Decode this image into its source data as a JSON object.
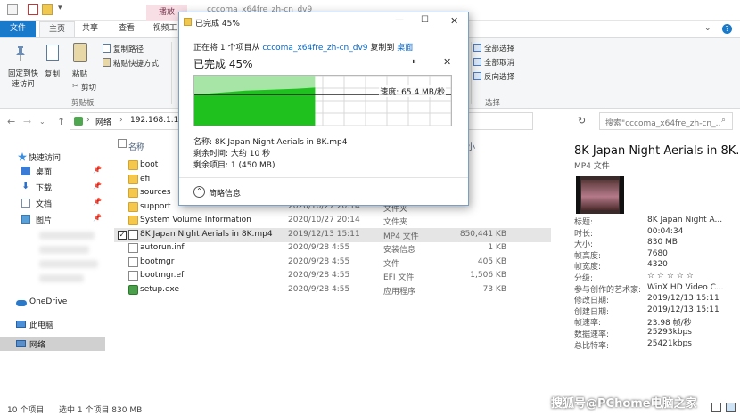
{
  "window": {
    "title": "cccoma_x64fre_zh-cn_dv9",
    "context_tab": "播放"
  },
  "quick_access": {
    "more": "▾"
  },
  "ribbon": {
    "tabs": [
      "文件",
      "主页",
      "共享",
      "查看",
      "视频工"
    ],
    "chevron": "⌄",
    "help": "?",
    "pin_label": "固定到快速访问",
    "copy_label": "复制",
    "paste_label": "粘贴",
    "cut_label": "剪切",
    "copy_path_label": "复制路径",
    "paste_shortcut_label": "粘贴快捷方式",
    "clipboard_group": "剪贴板",
    "select_all": "全部选择",
    "select_none": "全部取消",
    "invert_selection": "反向选择",
    "select_group": "选择"
  },
  "address": {
    "back": "←",
    "forward": "→",
    "recent": "⌄",
    "up": "↑",
    "separator": "›",
    "crumbs": [
      "网络",
      "192.168.1.1"
    ],
    "refresh": "↻",
    "search_placeholder": "搜索\"cccoma_x64fre_zh-cn_...",
    "search_icon": "⌕"
  },
  "nav_pane": {
    "quick_access": "快速访问",
    "items": [
      "桌面",
      "下载",
      "文档",
      "图片"
    ],
    "pin": "📌",
    "onedrive": "OneDrive",
    "this_pc": "此电脑",
    "network": "网络"
  },
  "file_list": {
    "columns": {
      "name": "名称",
      "size_partial": "小"
    },
    "rows": [
      {
        "name": "boot",
        "date": "",
        "type": "",
        "size": "",
        "icon": "folder"
      },
      {
        "name": "efi",
        "date": "",
        "type": "",
        "size": "",
        "icon": "folder"
      },
      {
        "name": "sources",
        "date": "2020/10/27 20:18",
        "type": "",
        "size": "",
        "icon": "folder"
      },
      {
        "name": "support",
        "date": "2020/10/27 20:14",
        "type": "文件夹",
        "size": "",
        "icon": "folder"
      },
      {
        "name": "System Volume Information",
        "date": "2020/10/27 20:14",
        "type": "文件夹",
        "size": "",
        "icon": "folder"
      },
      {
        "name": "8K Japan Night Aerials in 8K.mp4",
        "date": "2019/12/13 15:11",
        "type": "MP4 文件",
        "size": "850,441 KB",
        "icon": "video",
        "selected": true
      },
      {
        "name": "autorun.inf",
        "date": "2020/9/28 4:55",
        "type": "安装信息",
        "size": "1 KB",
        "icon": "file"
      },
      {
        "name": "bootmgr",
        "date": "2020/9/28 4:55",
        "type": "文件",
        "size": "405 KB",
        "icon": "file"
      },
      {
        "name": "bootmgr.efi",
        "date": "2020/9/28 4:55",
        "type": "EFI 文件",
        "size": "1,506 KB",
        "icon": "file"
      },
      {
        "name": "setup.exe",
        "date": "2020/9/28 4:55",
        "type": "应用程序",
        "size": "73 KB",
        "icon": "setup"
      }
    ]
  },
  "details": {
    "title": "8K Japan Night Aerials in 8K....",
    "subtitle": "MP4 文件",
    "props": [
      {
        "k": "标题:",
        "v": "8K Japan Night A..."
      },
      {
        "k": "时长:",
        "v": "00:04:34"
      },
      {
        "k": "大小:",
        "v": "830 MB"
      },
      {
        "k": "帧高度:",
        "v": "7680"
      },
      {
        "k": "帧宽度:",
        "v": "4320"
      },
      {
        "k": "分级:",
        "v": "☆ ☆ ☆ ☆ ☆"
      },
      {
        "k": "参与创作的艺术家:",
        "v": "WinX HD Video C..."
      },
      {
        "k": "修改日期:",
        "v": "2019/12/13 15:11"
      },
      {
        "k": "创建日期:",
        "v": "2019/12/13 15:11"
      },
      {
        "k": "帧速率:",
        "v": "23.98 帧/秒"
      },
      {
        "k": "数据速率:",
        "v": "25293kbps"
      },
      {
        "k": "总比特率:",
        "v": "25421kbps"
      }
    ]
  },
  "status": {
    "count": "10 个项目",
    "selected": "选中 1 个项目  830 MB"
  },
  "watermark": "搜狐号@PChome电脑之家",
  "dialog": {
    "title": "已完成 45%",
    "min": "—",
    "max": "☐",
    "close": "✕",
    "desc_prefix": "正在将 1 个项目从 ",
    "source": "cccoma_x64fre_zh-cn_dv9",
    "desc_mid": " 复制到 ",
    "destination": "桌面",
    "percent_label": "已完成 45%",
    "pause": "⏸",
    "cancel": "✕",
    "speed": "速度: 65.4 MB/秒",
    "file_name": "名称: 8K Japan Night Aerials in 8K.mp4",
    "time_left": "剩余时间: 大约 10 秒",
    "items_left": "剩余项目: 1 (450 MB)",
    "less_info_icon": "⌃",
    "less_info": "简略信息"
  },
  "chart_data": {
    "type": "area",
    "progress": 0.47,
    "x": [
      0,
      0.1,
      0.2,
      0.3,
      0.4,
      0.47
    ],
    "values": [
      0.62,
      0.66,
      0.7,
      0.72,
      0.74,
      0.76
    ],
    "current_speed_level": 0.62,
    "colors": {
      "fill": "#1fc11f",
      "remaining": "#a6e5a6",
      "line": "#222222"
    }
  }
}
